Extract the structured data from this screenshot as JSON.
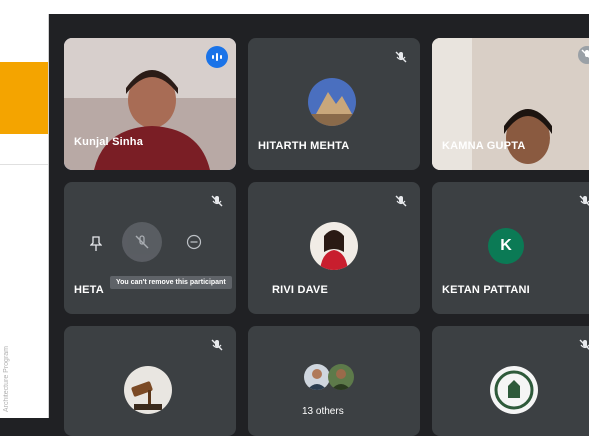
{
  "slide": {
    "footer_text": "Architecture Program"
  },
  "participants": [
    {
      "name": "Kunjal Sinha",
      "speaking": true
    },
    {
      "name": "HITARTH MEHTA",
      "mic_muted": true
    },
    {
      "name": "KAMNA GUPTA",
      "mic_muted": true
    },
    {
      "name": "HETA",
      "mic_muted": true
    },
    {
      "name": "RIVI DAVE",
      "mic_muted": true
    },
    {
      "name": "KETAN PATTANI",
      "mic_muted": true,
      "avatar_letter": "K",
      "avatar_color": "#0b7a55"
    },
    {
      "name": "",
      "mic_muted": true
    },
    {
      "name": "",
      "others_label": "13 others"
    },
    {
      "name": "",
      "mic_muted": true
    }
  ],
  "tooltip": {
    "text": "You can't remove this participant"
  },
  "colors": {
    "tile": "#3c4043",
    "background": "#202124",
    "speaking_outline": "#8ab4f8",
    "accent_band": "#f4a400"
  },
  "icons": [
    "mic-off-icon",
    "audio-wave-icon",
    "pin-icon",
    "remove-participant-icon",
    "more-options-icon"
  ]
}
